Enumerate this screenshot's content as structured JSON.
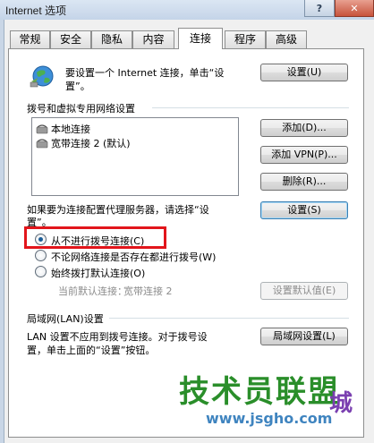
{
  "window": {
    "title": "Internet 选项"
  },
  "tabs": [
    {
      "label": "常规"
    },
    {
      "label": "安全"
    },
    {
      "label": "隐私"
    },
    {
      "label": "内容"
    },
    {
      "label": "连接",
      "active": true
    },
    {
      "label": "程序"
    },
    {
      "label": "高级"
    }
  ],
  "setup": {
    "text_line1": "要设置一个 Internet 连接，单击“设",
    "text_line2": "置”。",
    "button_label": "设置(U)"
  },
  "dialup": {
    "group_title": "拨号和虚拟专用网络设置",
    "connections": [
      {
        "name": "本地连接"
      },
      {
        "name": "宽带连接 2 (默认)"
      }
    ],
    "add_label": "添加(D)...",
    "add_vpn_label": "添加 VPN(P)...",
    "remove_label": "删除(R)...",
    "proxy_text_line1": "如果要为连接配置代理服务器，请选择“设",
    "proxy_text_line2": "置”。",
    "settings_label": "设置(S)",
    "options": [
      {
        "label": "从不进行拨号连接(C)",
        "checked": true
      },
      {
        "label": "不论网络连接是否存在都进行拨号(W)",
        "checked": false
      },
      {
        "label": "始终拨打默认连接(O)",
        "checked": false
      }
    ],
    "current_default_label": "当前默认连接：",
    "current_default_value": "宽带连接 2",
    "set_default_label": "设置默认值(E)"
  },
  "lan": {
    "group_title": "局域网(LAN)设置",
    "text_line1": "LAN 设置不应用到拨号连接。对于拨号设",
    "text_line2": "置，单击上面的“设置”按钮。",
    "button_label": "局域网设置(L)"
  },
  "watermark": {
    "main": "技术员联盟",
    "url": "www.jsgho.com",
    "side": "城"
  }
}
